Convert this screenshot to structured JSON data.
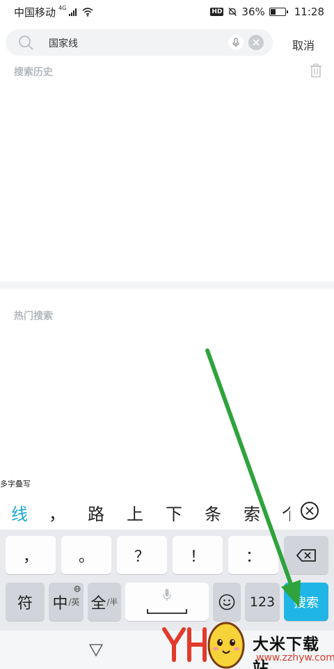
{
  "status_bar": {
    "carrier": "中国移动",
    "network": "4G",
    "battery": "36%",
    "battery_level": 0.36,
    "time": "11:28"
  },
  "search": {
    "query": "国家线",
    "cancel_label": "取消"
  },
  "history": {
    "title": "搜索历史"
  },
  "hot": {
    "title": "热门搜索"
  },
  "keyboard": {
    "candidate_tag": "多字叠写",
    "candidates": [
      "线",
      "，",
      "路",
      "上",
      "下",
      "条",
      "索",
      "个"
    ],
    "row1": [
      "，",
      "。",
      "？",
      "！",
      "："
    ],
    "row2": {
      "symbols": "符",
      "lang_main": "中",
      "lang_alt": "/英",
      "width_main": "全",
      "width_alt": "/半",
      "numbers": "123",
      "search": "搜索"
    }
  },
  "watermark": {
    "brand": "大米下载站",
    "url": "www.zzhyw.com"
  },
  "colors": {
    "accent": "#1fb6e6",
    "arrow": "#2fa33c"
  }
}
